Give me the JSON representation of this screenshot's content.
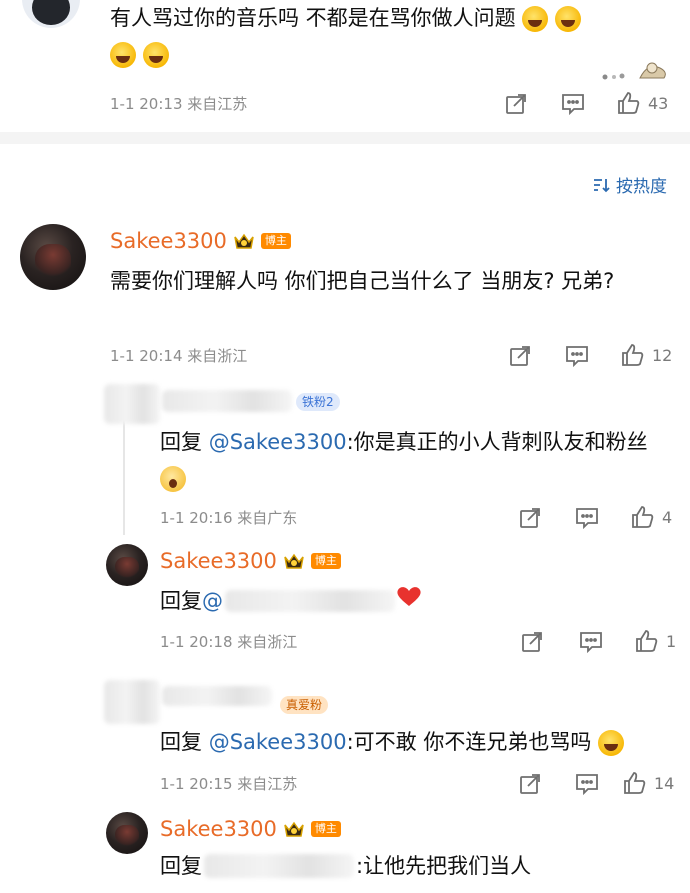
{
  "top_comment": {
    "text": "有人骂过你的音乐吗 不都是在骂你做人问题",
    "time": "1-1 20:13 来自江苏",
    "likes": "43"
  },
  "sort_label": "按热度",
  "main_comment": {
    "user": "Sakee3300",
    "badge": "博主",
    "text": "需要你们理解人吗 你们把自己当什么了 当朋友? 兄弟?",
    "time": "1-1 20:14 来自浙江",
    "likes": "12"
  },
  "replies": [
    {
      "fan_badge": "铁粉2",
      "prefix": "回复 ",
      "mention": "@Sakee3300",
      "text": ":你是真正的小人背刺队友和粉丝",
      "time": "1-1 20:16 来自广东",
      "likes": "4"
    },
    {
      "user": "Sakee3300",
      "badge": "博主",
      "prefix": "回复 ",
      "mention": "@",
      "time": "1-1 20:18 来自浙江",
      "likes": "1"
    },
    {
      "fan_badge": "真爱粉",
      "prefix": "回复 ",
      "mention": "@Sakee3300",
      "text": ":可不敢 你不连兄弟也骂吗",
      "time": "1-1 20:15 来自江苏",
      "likes": "14"
    },
    {
      "user": "Sakee3300",
      "badge": "博主",
      "prefix": "回复 ",
      "text": ":让他先把我们当人"
    }
  ],
  "colors": {
    "username": "#e86b28",
    "mention": "#2b6ab0",
    "badge": "#ff8a00",
    "meta": "#8c8c8c"
  },
  "icons": [
    "share-icon",
    "comment-icon",
    "like-icon",
    "sort-icon",
    "crown-icon",
    "heart-icon"
  ]
}
